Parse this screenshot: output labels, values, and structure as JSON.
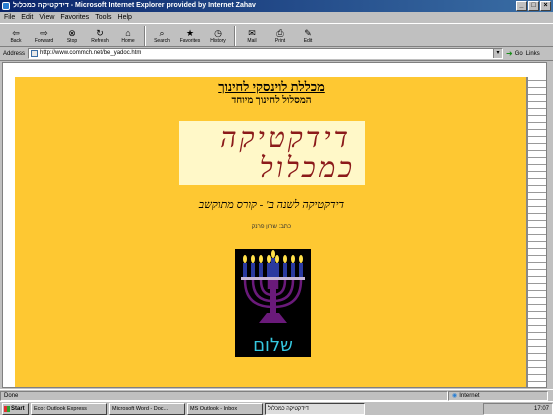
{
  "window": {
    "title": "דידקטיקה כמכלול - Microsoft Internet Explorer provided by Internet Zahav",
    "minimize": "_",
    "maximize": "□",
    "close": "×"
  },
  "menu": {
    "items": [
      "File",
      "Edit",
      "View",
      "Favorites",
      "Tools",
      "Help"
    ]
  },
  "toolbar": {
    "buttons": [
      {
        "label": "Back",
        "icon": "back-arrow-icon",
        "glyph": "⇦"
      },
      {
        "label": "Forward",
        "icon": "forward-arrow-icon",
        "glyph": "⇨"
      },
      {
        "label": "Stop",
        "icon": "stop-icon",
        "glyph": "⊗"
      },
      {
        "label": "Refresh",
        "icon": "refresh-icon",
        "glyph": "↻"
      },
      {
        "label": "Home",
        "icon": "home-icon",
        "glyph": "⌂"
      },
      {
        "label": "Search",
        "icon": "search-icon",
        "glyph": "⌕"
      },
      {
        "label": "Favorites",
        "icon": "favorites-icon",
        "glyph": "★"
      },
      {
        "label": "History",
        "icon": "history-icon",
        "glyph": "◷"
      },
      {
        "label": "Mail",
        "icon": "mail-icon",
        "glyph": "✉"
      },
      {
        "label": "Print",
        "icon": "print-icon",
        "glyph": "⎙"
      },
      {
        "label": "Edit",
        "icon": "edit-icon",
        "glyph": "✎"
      }
    ]
  },
  "address": {
    "label": "Address",
    "url": "http://www.commch.net/be_yadoc.htm",
    "go_label": "Go",
    "links_label": "Links"
  },
  "page": {
    "heading": "מכללת לוינסקי לחינוך",
    "subheading": "המסלול לחינוך מיוחד",
    "logo_line1": "דידקטיקה",
    "logo_line2": "כמכלול",
    "subtitle": "דידקטיקה לשנה ב' - קורס מתוקשב",
    "author": "כתב: שרון פרנק",
    "menorah_text": "שלום"
  },
  "status": {
    "left": "Done",
    "zone": "Internet"
  },
  "taskbar": {
    "start": "Start",
    "tasks": [
      "Eco: Outlook Express",
      "Microsoft Word - Doc...",
      "MS Outlook - Inbox",
      "דידקטיקה כמכלול"
    ],
    "clock": "17:07"
  },
  "colors": {
    "page_bg": "#fec832",
    "logo_text": "#8b1a1a",
    "menorah_text": "#35c8e0",
    "menorah_body": "#6a1a7a"
  }
}
